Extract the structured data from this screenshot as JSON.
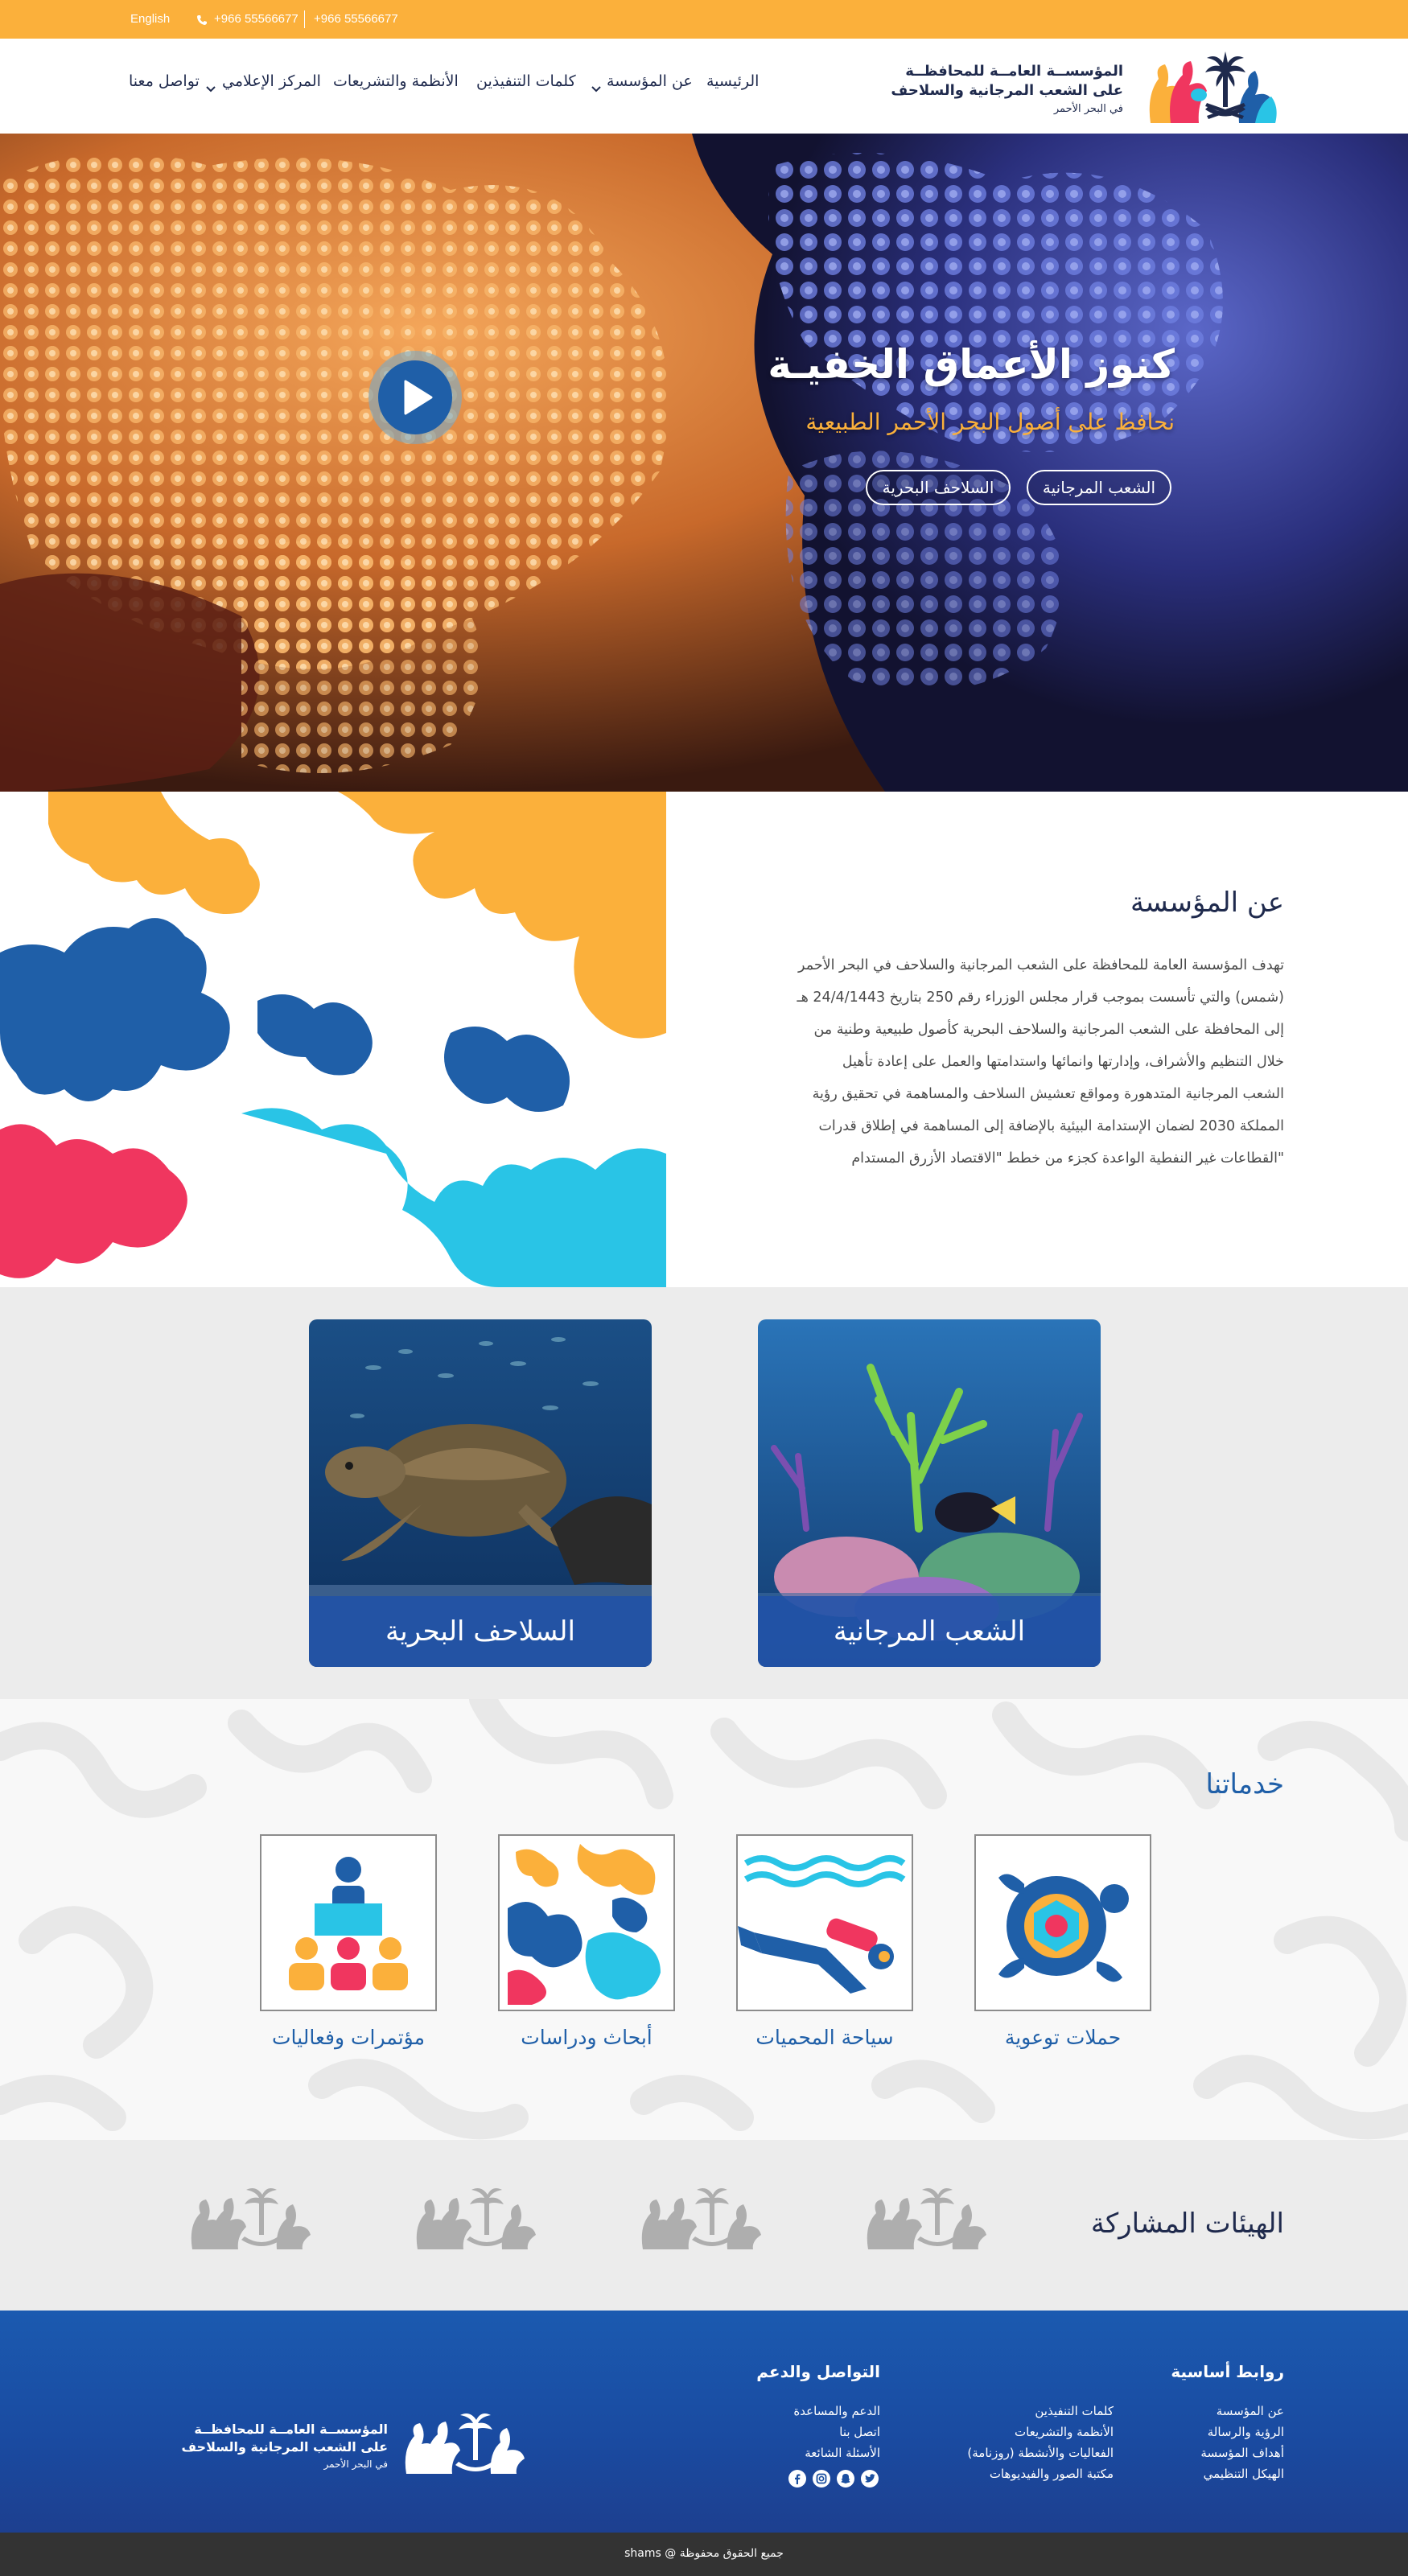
{
  "topbar": {
    "language": "English",
    "phone_1": "+966 55566677",
    "phone_2": "+966 55566677"
  },
  "header": {
    "logo_line_1": "المؤسســة العامــة للمحافظــة",
    "logo_line_2": "على الشعب المرجانية والسلاحف",
    "logo_line_3": "في البحر الأحمر",
    "nav": [
      "الرئيسية",
      "عن المؤسسة",
      "كلمات التنفيذين",
      "الأنظمة والتشريعات",
      "المركز الإعلامي",
      "تواصل معنا"
    ]
  },
  "hero": {
    "title": "كنوز الأعماق الخفيـة",
    "subtitle": "نحافظ على أصول البحر الأحمر الطبيعية",
    "button_coral": "الشعب المرجانية",
    "button_turtles": "السلاحف البحرية"
  },
  "about": {
    "title": "عن المؤسسة",
    "lines": [
      "تهدف المؤسسة العامة للمحافظة على الشعب المرجانية والسلاحف في البحر الأحمر",
      "(شمس) والتي تأسست بموجب قرار مجلس الوزراء رقم 250 بتاريخ 24/4/1443 هـ",
      "إلى المحافظة على الشعب المرجانية والسلاحف البحرية كأصول طبيعية وطنية من",
      "خلال التنظيم والأشراف، وإدارتها وانمائها واستدامتها والعمل على إعادة تأهيل",
      "الشعب المرجانية المتدهورة ومواقع تعشيش السلاحف والمساهمة في تحقيق رؤية",
      "المملكة 2030 لضمان الإستدامة البيئية بالإضافة إلى المساهمة في إطلاق قدرات",
      "\"القطاعات غير النفطية الواعدة كجزء من خطط \"الاقتصاد الأزرق المستدام"
    ]
  },
  "cards": {
    "coral": "الشعب المرجانية",
    "turtles": "السلاحف البحرية"
  },
  "services": {
    "title": "خدماتنا",
    "items": [
      "حملات توعوية",
      "سياحة المحميات",
      "أبحاث ودراسات",
      "مؤتمرات وفعاليات"
    ]
  },
  "partners": {
    "title": "الهيئات المشاركة"
  },
  "footer": {
    "links_title": "روابط أساسية",
    "links_col1": [
      "عن المؤسسة",
      "الرؤية والرسالة",
      "أهداف المؤسسة",
      "الهيكل التنظيمي"
    ],
    "links_col2": [
      "كلمات التنفيذين",
      "الأنظمة والتشريعات",
      "الفعاليات والأنشطة (روزنامة)",
      "مكتبة الصور والفيديوهات"
    ],
    "contact_title": "التواصل والدعم",
    "contact_links": [
      "الدعم والمساعدة",
      "اتصل بنا",
      "الأسئلة الشائعة"
    ],
    "logo_line_1": "المؤسســة العامــة للمحافظــة",
    "logo_line_2": "على الشعب المرجانية والسلاحف",
    "logo_line_3": "في البحر الأحمر",
    "social_icons": [
      "twitter-icon",
      "snapchat-icon",
      "instagram-icon",
      "facebook-icon"
    ]
  },
  "copyright": "جميع الحقوق محفوظة @ shams",
  "colors": {
    "accent_orange": "#fbb03b",
    "navy": "#1f2a4d",
    "blue": "#1f5fa8",
    "footer_blue": "#1b4fa0"
  }
}
